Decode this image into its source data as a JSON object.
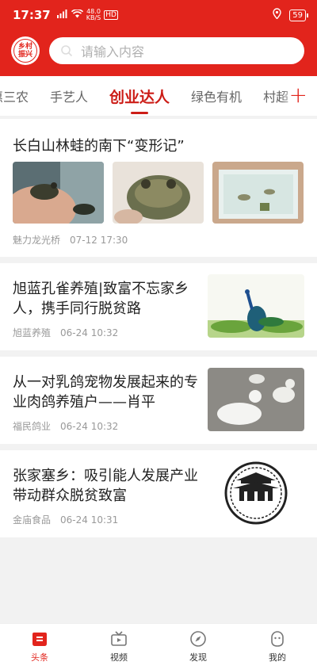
{
  "status": {
    "time": "17:37",
    "signal": "5G",
    "speed_value": "48.0",
    "speed_unit": "KB/S",
    "hd": "HD",
    "battery": "59"
  },
  "logo": {
    "line1": "乡村",
    "line2": "振兴"
  },
  "search": {
    "placeholder": "请输入内容"
  },
  "tabs": [
    "惠三农",
    "手艺人",
    "创业达人",
    "绿色有机",
    "村超"
  ],
  "active_tab": "创业达人",
  "tab_add_label": "+",
  "articles": [
    {
      "title": "长白山林蛙的南下“变形记”",
      "source": "魅力龙光桥",
      "time": "07-12 17:30"
    },
    {
      "title": "旭蓝孔雀养殖|致富不忘家乡人，携手同行脱贫路",
      "source": "旭蓝养殖",
      "time": "06-24 10:32"
    },
    {
      "title": "从一对乳鸽宠物发展起来的专业肉鸽养殖户——肖平",
      "source": "福民鸽业",
      "time": "06-24 10:32"
    },
    {
      "title": "张家塞乡：吸引能人发展产业 带动群众脱贫致富",
      "source": "金庙食品",
      "time": "06-24 10:31"
    }
  ],
  "logo_image_text": "金城庙",
  "nav": [
    {
      "label": "头条",
      "icon": "headline-icon",
      "active": true
    },
    {
      "label": "视频",
      "icon": "tv-icon",
      "active": false
    },
    {
      "label": "发现",
      "icon": "compass-icon",
      "active": false
    },
    {
      "label": "我的",
      "icon": "profile-icon",
      "active": false
    }
  ],
  "colors": {
    "brand_red": "#e2241c",
    "active_tab": "#cc1d17",
    "meta_gray": "#999999"
  }
}
